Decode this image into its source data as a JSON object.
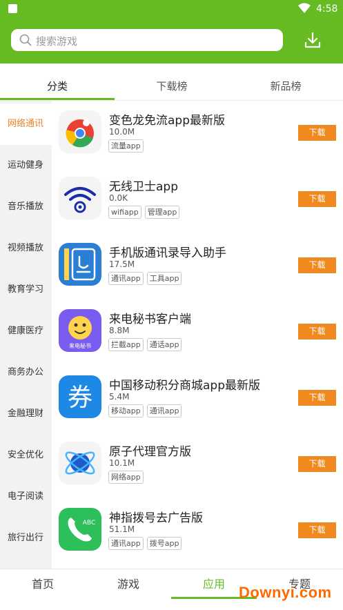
{
  "status_bar": {
    "time": "4:58"
  },
  "header": {
    "search_placeholder": "搜索游戏"
  },
  "tabs": [
    {
      "label": "分类",
      "active": true
    },
    {
      "label": "下载榜",
      "active": false
    },
    {
      "label": "新品榜",
      "active": false
    }
  ],
  "sidebar": {
    "items": [
      {
        "label": "网络通讯",
        "active": true
      },
      {
        "label": "运动健身"
      },
      {
        "label": "音乐播放"
      },
      {
        "label": "视频播放"
      },
      {
        "label": "教育学习"
      },
      {
        "label": "健康医疗"
      },
      {
        "label": "商务办公"
      },
      {
        "label": "金融理财"
      },
      {
        "label": "安全优化"
      },
      {
        "label": "电子阅读"
      },
      {
        "label": "旅行出行"
      }
    ]
  },
  "apps": [
    {
      "name": "变色龙免流app最新版",
      "size": "10.0M",
      "tags": [
        "流量app"
      ],
      "download_label": "下载",
      "icon": "chameleon-icon"
    },
    {
      "name": "无线卫士app",
      "size": "0.0K",
      "tags": [
        "wifiapp",
        "管理app"
      ],
      "download_label": "下载",
      "icon": "wifi-gear-icon"
    },
    {
      "name": "手机版通讯录导入助手",
      "size": "17.5M",
      "tags": [
        "通讯app",
        "工具app"
      ],
      "download_label": "下载",
      "icon": "contacts-book-icon"
    },
    {
      "name": "来电秘书客户端",
      "size": "8.8M",
      "tags": [
        "拦截app",
        "通话app"
      ],
      "download_label": "下载",
      "icon": "call-secretary-icon",
      "icon_text": "来电秘书"
    },
    {
      "name": "中国移动积分商城app最新版",
      "size": "5.4M",
      "tags": [
        "移动app",
        "通讯app"
      ],
      "download_label": "下载",
      "icon": "coupon-icon",
      "icon_text": "券"
    },
    {
      "name": "原子代理官方版",
      "size": "10.1M",
      "tags": [
        "网络app"
      ],
      "download_label": "下载",
      "icon": "atom-icon"
    },
    {
      "name": "神指拨号去广告版",
      "size": "51.1M",
      "tags": [
        "通讯app",
        "拨号app"
      ],
      "download_label": "下载",
      "icon": "phone-dial-icon",
      "icon_text": "ABC"
    }
  ],
  "bottom_nav": [
    {
      "label": "首页"
    },
    {
      "label": "游戏"
    },
    {
      "label": "应用",
      "active": true
    },
    {
      "label": "专题"
    }
  ],
  "watermark": "Downyi.com",
  "colors": {
    "brand_green": "#66bb22",
    "accent_orange": "#f08a20",
    "active_side": "#e8832a"
  }
}
